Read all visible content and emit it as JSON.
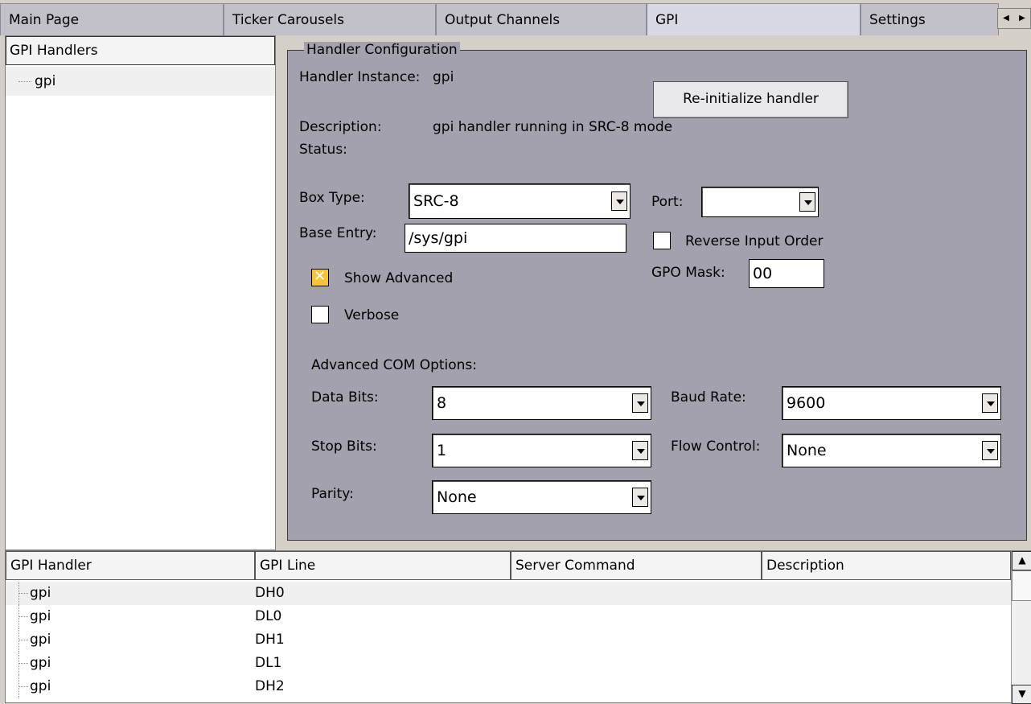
{
  "tabs": [
    {
      "label": "Main Page"
    },
    {
      "label": "Ticker Carousels"
    },
    {
      "label": "Output Channels"
    },
    {
      "label": "GPI"
    },
    {
      "label": "Settings"
    }
  ],
  "left": {
    "header": "GPI Handlers",
    "items": [
      {
        "label": "gpi"
      }
    ]
  },
  "config": {
    "title": "Handler Configuration",
    "instance_label": "Handler Instance:",
    "instance_value": "gpi",
    "reinit_button": "Re-initialize handler",
    "description_label": "Description:",
    "description_value": "gpi handler running in SRC-8 mode",
    "status_label": "Status:",
    "status_value": "",
    "box_type_label": "Box Type:",
    "box_type_value": "SRC-8",
    "port_label": "Port:",
    "port_value": "",
    "base_entry_label": "Base Entry:",
    "base_entry_value": "/sys/gpi",
    "reverse_label": "Reverse Input Order",
    "reverse_checked": false,
    "show_advanced_label": "Show Advanced",
    "show_advanced_checked": true,
    "gpo_mask_label": "GPO Mask:",
    "gpo_mask_value": "00",
    "verbose_label": "Verbose",
    "verbose_checked": false,
    "advanced_title": "Advanced COM Options:",
    "data_bits_label": "Data Bits:",
    "data_bits_value": "8",
    "baud_rate_label": "Baud Rate:",
    "baud_rate_value": "9600",
    "stop_bits_label": "Stop Bits:",
    "stop_bits_value": "1",
    "flow_control_label": "Flow Control:",
    "flow_control_value": "None",
    "parity_label": "Parity:",
    "parity_value": "None"
  },
  "table": {
    "columns": [
      "GPI Handler",
      "GPI Line",
      "Server Command",
      "Description"
    ],
    "rows": [
      {
        "handler": "gpi",
        "line": "DH0",
        "command": "",
        "description": ""
      },
      {
        "handler": "gpi",
        "line": "DL0",
        "command": "",
        "description": ""
      },
      {
        "handler": "gpi",
        "line": "DH1",
        "command": "",
        "description": ""
      },
      {
        "handler": "gpi",
        "line": "DL1",
        "command": "",
        "description": ""
      },
      {
        "handler": "gpi",
        "line": "DH2",
        "command": "",
        "description": ""
      }
    ]
  }
}
